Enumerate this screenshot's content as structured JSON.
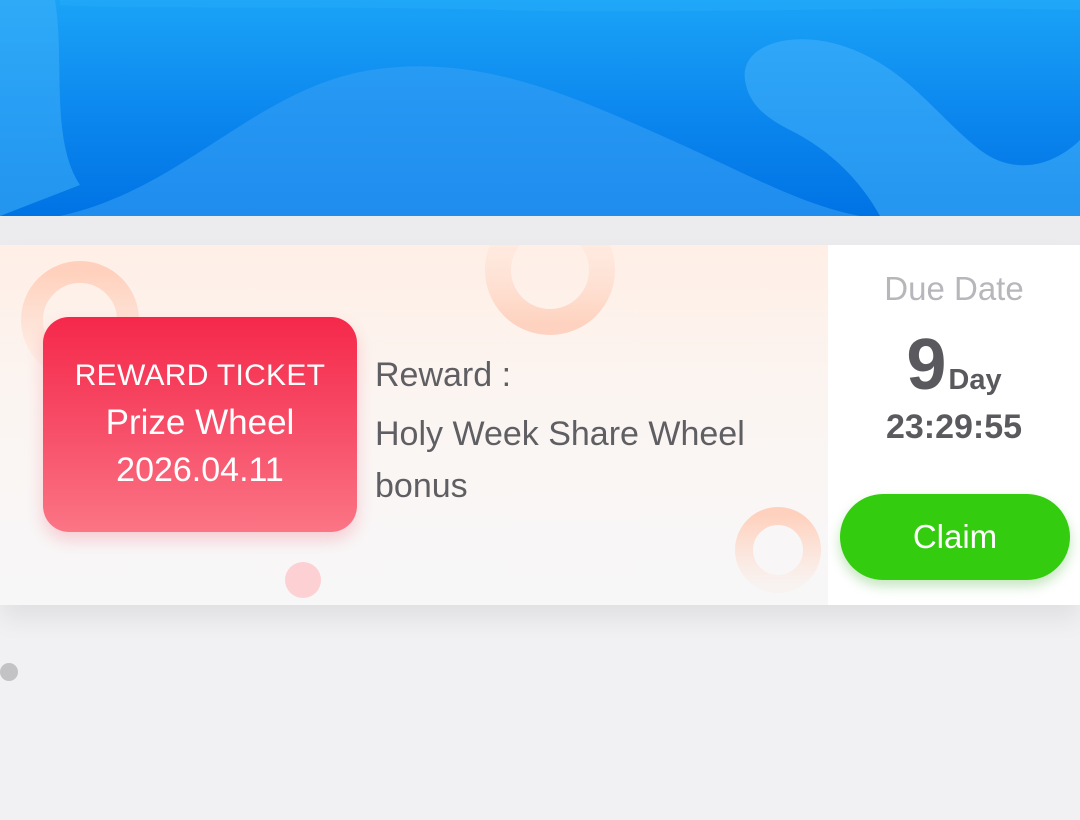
{
  "ticket": {
    "type_label": "REWARD TICKET",
    "name": "Prize Wheel",
    "date": "2026.04.11"
  },
  "reward": {
    "label": "Reward :",
    "description": "Holy Week Share Wheel bonus"
  },
  "due": {
    "label": "Due Date",
    "days": "9",
    "days_unit": "Day",
    "time_left": "23:29:55"
  },
  "actions": {
    "claim_label": "Claim"
  },
  "colors": {
    "header_blue": "#0b86ee",
    "ticket_red": "#f5284a",
    "claim_green": "#33cc0e"
  }
}
